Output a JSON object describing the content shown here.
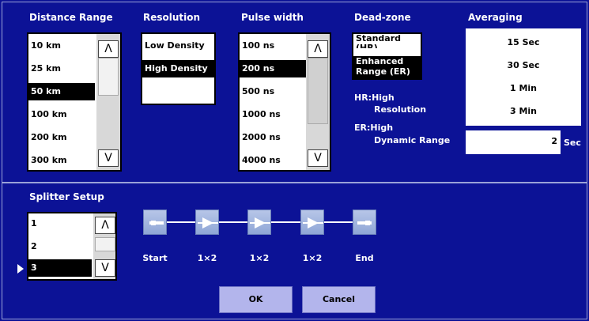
{
  "distance_range": {
    "label": "Distance Range",
    "items": [
      "10 km",
      "25 km",
      "50 km",
      "100 km",
      "200 km",
      "300 km"
    ],
    "selected": "50 km",
    "scroll_up": "Λ",
    "scroll_down": "V"
  },
  "resolution": {
    "label": "Resolution",
    "items": [
      "Low Density",
      "High Density"
    ],
    "selected": "High Density"
  },
  "pulse_width": {
    "label": "Pulse width",
    "items": [
      "100 ns",
      "200 ns",
      "500 ns",
      "1000 ns",
      "2000 ns",
      "4000 ns"
    ],
    "selected": "200 ns",
    "scroll_up": "Λ",
    "scroll_down": "V"
  },
  "dead_zone": {
    "label": "Dead-zone",
    "items": [
      {
        "line1": "Standard",
        "line2": "(HR)"
      },
      {
        "line1": "Enhanced",
        "line2": "Range (ER)"
      }
    ],
    "selected": "Enhanced",
    "notes": {
      "hr_key": "HR:High",
      "hr_value": "Resolution",
      "er_key": "ER:High",
      "er_value": "Dynamic Range"
    }
  },
  "averaging": {
    "label": "Averaging",
    "items": [
      "15 Sec",
      "30 Sec",
      "1 Min",
      "3 Min"
    ],
    "custom_value": "2",
    "custom_unit": "Sec"
  },
  "splitter_setup": {
    "label": "Splitter Setup",
    "items": [
      "1",
      "2",
      "3"
    ],
    "selected": "3",
    "scroll_up": "Λ",
    "scroll_down": "V",
    "chain": [
      "Start",
      "1×2",
      "1×2",
      "1×2",
      "End"
    ]
  },
  "buttons": {
    "ok": "OK",
    "cancel": "Cancel"
  },
  "colors": {
    "background": "#0c1296",
    "selected_row": "#000000",
    "button": "#b3b5ec"
  }
}
